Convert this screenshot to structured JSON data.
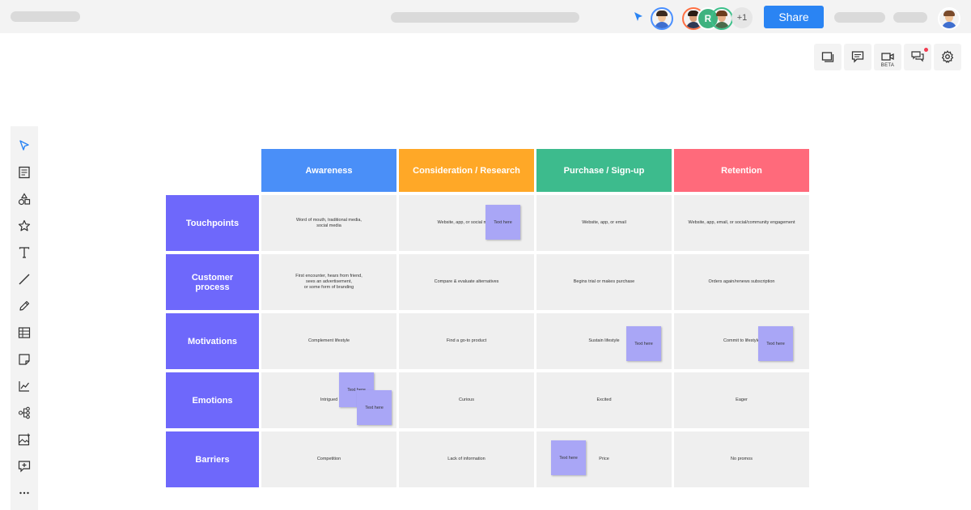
{
  "topbar": {
    "share_label": "Share",
    "more_collaborators": "+1",
    "collaborator_initial": "R"
  },
  "right_toolbar": {
    "items": [
      "frames-icon",
      "comment-icon",
      "video-icon",
      "chat-icon",
      "settings-icon"
    ],
    "video_badge": "BETA"
  },
  "left_toolbar": {
    "items": [
      "select-icon",
      "page-icon",
      "shapes-icon",
      "star-icon",
      "text-icon",
      "line-icon",
      "pen-icon",
      "table-icon",
      "sticky-note-icon",
      "chart-icon",
      "mindmap-icon",
      "image-icon",
      "add-frame-icon",
      "more-icon"
    ]
  },
  "board": {
    "columns": [
      {
        "label": "Awareness",
        "color": "#4a8ff8"
      },
      {
        "label": "Consideration / Research",
        "color": "#ffa827"
      },
      {
        "label": "Purchase / Sign-up",
        "color": "#3dbb8d"
      },
      {
        "label": "Retention",
        "color": "#ff6a7b"
      }
    ],
    "rows": [
      {
        "label": "Touchpoints",
        "cells": [
          "Word of mouth, traditional media,\nsocial media",
          "Website, app, or social media",
          "Website, app, or email",
          "Website, app, email, or social/community engagement"
        ]
      },
      {
        "label": "Customer\nprocess",
        "cells": [
          "First encounter, hears from friend,\nsees an advertisement,\nor some form of branding",
          "Compare & evaluate alternatives",
          "Begins trial or makes purchase",
          "Orders again/renews subscription"
        ]
      },
      {
        "label": "Motivations",
        "cells": [
          "Complement lifestyle",
          "Find a go-to product",
          "Sustain lifestyle",
          "Commit to lifestyle"
        ]
      },
      {
        "label": "Emotions",
        "cells": [
          "Intrigued",
          "Curious",
          "Excited",
          "Eager"
        ]
      },
      {
        "label": "Barriers",
        "cells": [
          "Competition",
          "Lack of information",
          "Price",
          "No promos"
        ]
      }
    ],
    "sticky_text": "Text here",
    "row_header_color": "#6e68fb",
    "sticky_color": "#a9a6f6"
  }
}
